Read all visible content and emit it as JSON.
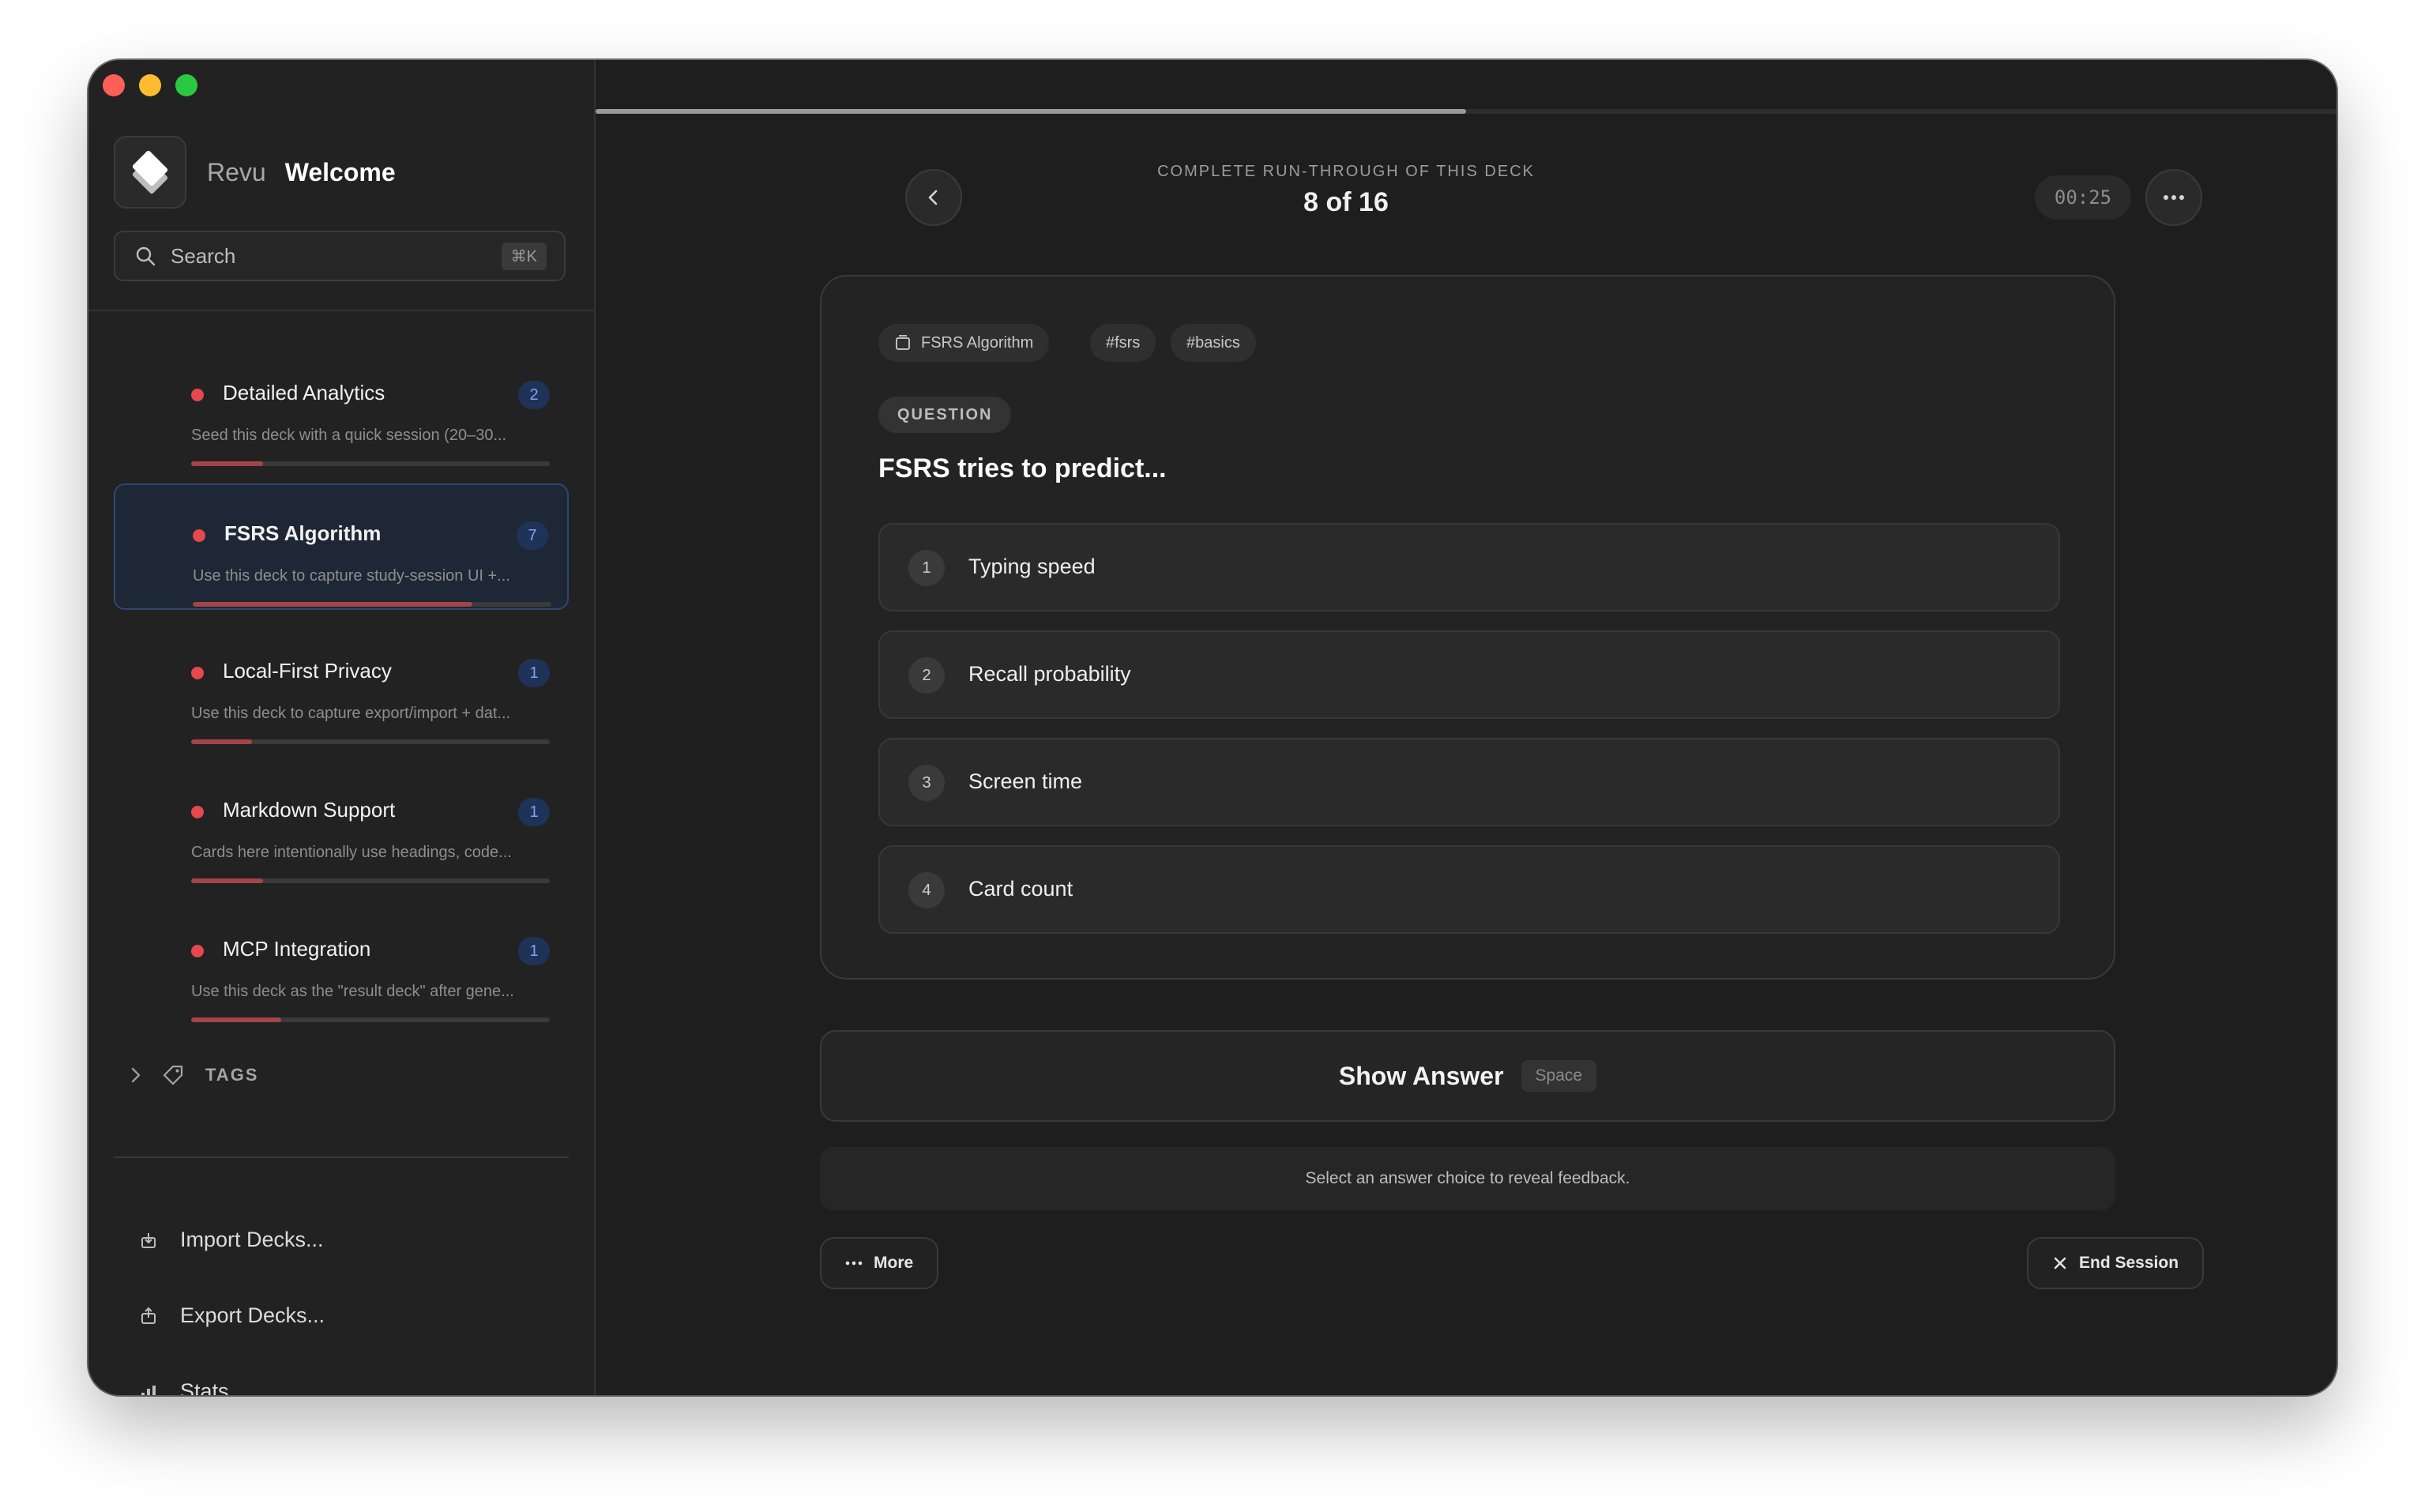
{
  "app": {
    "name": "Revu",
    "page": "Welcome"
  },
  "search": {
    "label": "Search",
    "shortcut": "⌘K"
  },
  "decks": [
    {
      "title": "Detailed Analytics",
      "count": "2",
      "description": "Seed this deck with a quick session (20–30...",
      "progress": 0.2,
      "active": false
    },
    {
      "title": "FSRS Algorithm",
      "count": "7",
      "description": "Use this deck to capture study-session UI +...",
      "progress": 0.78,
      "active": true
    },
    {
      "title": "Local-First Privacy",
      "count": "1",
      "description": "Use this deck to capture export/import + dat...",
      "progress": 0.17,
      "active": false
    },
    {
      "title": "Markdown Support",
      "count": "1",
      "description": "Cards here intentionally use headings, code...",
      "progress": 0.2,
      "active": false
    },
    {
      "title": "MCP Integration",
      "count": "1",
      "description": "Use this deck as the \"result deck\" after gene...",
      "progress": 0.25,
      "active": false
    }
  ],
  "sidebar": {
    "tags_label": "TAGS",
    "actions": [
      {
        "label": "Import Decks...",
        "icon": "import-icon"
      },
      {
        "label": "Export Decks...",
        "icon": "export-icon"
      },
      {
        "label": "Stats",
        "icon": "stats-icon"
      }
    ]
  },
  "session": {
    "subtitle": "COMPLETE RUN-THROUGH OF THIS DECK",
    "count": "8 of 16",
    "timer": "00:25",
    "progress": 0.5
  },
  "card": {
    "chips": [
      "FSRS Algorithm",
      "#fsrs",
      "#basics"
    ],
    "question_label": "QUESTION",
    "question": "FSRS tries to predict...",
    "options": [
      {
        "num": "1",
        "text": "Typing speed"
      },
      {
        "num": "2",
        "text": "Recall probability"
      },
      {
        "num": "3",
        "text": "Screen time"
      },
      {
        "num": "4",
        "text": "Card count"
      }
    ]
  },
  "actions": {
    "show_answer": "Show Answer",
    "show_answer_key": "Space",
    "feedback": "Select an answer choice to reveal feedback.",
    "more": "More",
    "end_session": "End Session"
  },
  "colors": {
    "accent_red": "#e5484d",
    "badge_blue": "#7da4ee",
    "active_border": "#2e4770"
  }
}
